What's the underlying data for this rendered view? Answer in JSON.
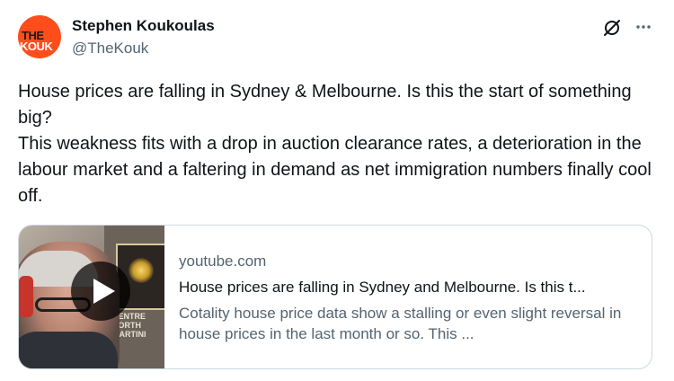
{
  "author": {
    "name": "Stephen Koukoulas",
    "handle": "@TheKouk",
    "avatar_text_top": "THE",
    "avatar_text_bottom": "KOUK"
  },
  "icons": {
    "grok": "grok-slash-icon",
    "more": "more-dots-icon",
    "play": "play-icon"
  },
  "tweet": {
    "text": "House prices are falling in Sydney & Melbourne. Is this the start of something big?\nThis weakness fits with a drop in auction clearance rates, a deterioration in the labour market and a faltering in demand as net immigration numbers finally cool off."
  },
  "card": {
    "domain": "youtube.com",
    "title": "House prices are falling in Sydney and Melbourne. Is this t...",
    "description": "Cotality house price data show a stalling or even slight reversal in house prices in the last month or so. This ...",
    "thumbnail_sign": "CENTRE NORTH MARTINI"
  },
  "colors": {
    "text": "#0f1419",
    "secondary": "#536471",
    "border": "#cfd9de",
    "avatar_bg": "#ff4d1c"
  }
}
